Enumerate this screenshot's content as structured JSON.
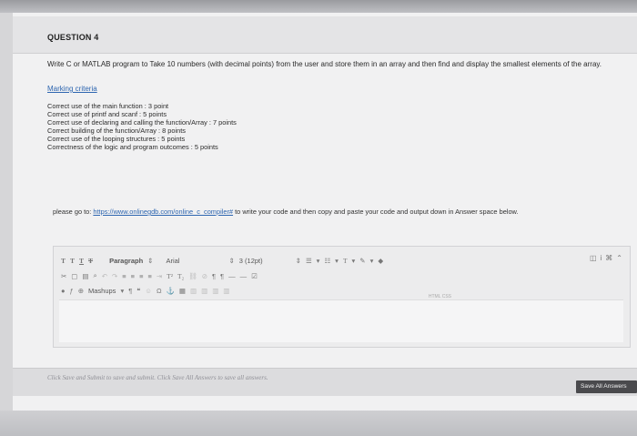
{
  "question": {
    "title": "QUESTION 4",
    "prompt": "Write C or MATLAB program to Take 10 numbers (with decimal points) from the user and store them in an array and then find and display the smallest elements of the array.",
    "marking_label": "Marking criteria",
    "criteria": [
      "Correct use of the main function : 3 point",
      "Correct use of printf and scanf : 5 points",
      "Correct use of declaring and calling the function/Array : 7 points",
      "Correct building of the function/Array : 8 points",
      "Correct use of the looping structures : 5 points",
      "Correctness of the logic and program outcomes : 5 points"
    ],
    "instructions_prefix": "please go to:",
    "instructions_link": "https://www.onlinegdb.com/online_c_compiler#",
    "instructions_suffix": "to write your code and then copy and paste your code and output down in Answer space below."
  },
  "editor": {
    "paragraph_label": "Paragraph",
    "font_label": "Arial",
    "size_label": "3 (12pt)",
    "mashups_label": "Mashups",
    "html_css_label": "HTML CSS"
  },
  "footer": {
    "note": "Click Save and Submit to save and submit. Click Save All Answers to save all answers.",
    "save_all_label": "Save All Answers"
  },
  "colors": {
    "link": "#2e66b0",
    "button": "#4a4a4d",
    "page": "#f1f1f2"
  }
}
